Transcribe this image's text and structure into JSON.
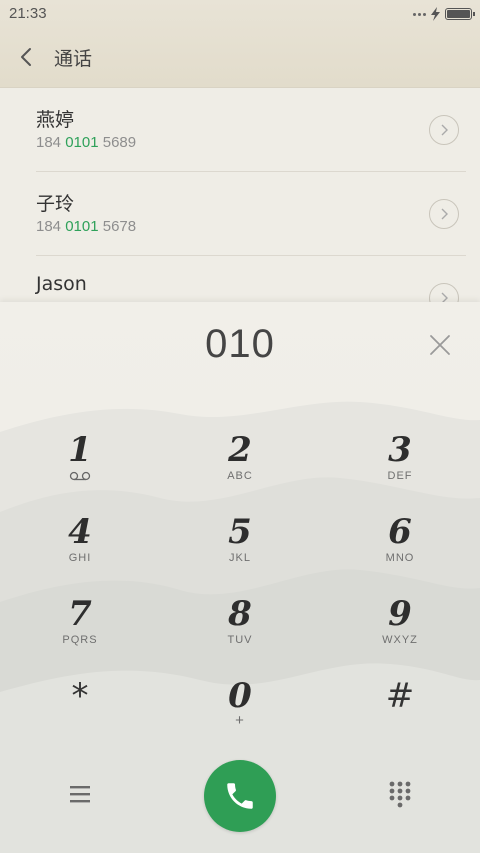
{
  "status": {
    "time": "21:33"
  },
  "header": {
    "title": "通话"
  },
  "contacts": [
    {
      "name": "燕婷",
      "number_pre": "184 ",
      "number_match": "0101",
      "number_post": " 5689"
    },
    {
      "name": "子玲",
      "number_pre": "184 ",
      "number_match": "0101",
      "number_post": " 5678"
    },
    {
      "name": "Jason",
      "number_pre": "",
      "number_match": "",
      "number_post": ""
    }
  ],
  "dialer": {
    "input": "010",
    "keys": [
      {
        "digit": "1",
        "letters": ""
      },
      {
        "digit": "2",
        "letters": "ABC"
      },
      {
        "digit": "3",
        "letters": "DEF"
      },
      {
        "digit": "4",
        "letters": "GHI"
      },
      {
        "digit": "5",
        "letters": "JKL"
      },
      {
        "digit": "6",
        "letters": "MNO"
      },
      {
        "digit": "7",
        "letters": "PQRS"
      },
      {
        "digit": "8",
        "letters": "TUV"
      },
      {
        "digit": "9",
        "letters": "WXYZ"
      },
      {
        "digit": "*",
        "letters": ""
      },
      {
        "digit": "0",
        "letters": "+"
      },
      {
        "digit": "#",
        "letters": ""
      }
    ]
  },
  "colors": {
    "accent_green": "#2f9e55",
    "header_bg": "#e2dccb",
    "background": "#efede6"
  },
  "icons": {
    "back": "chevron-left-icon",
    "clear": "close-icon",
    "call": "phone-icon",
    "menu": "menu-icon",
    "keypad": "keypad-icon",
    "voicemail": "voicemail-icon"
  }
}
